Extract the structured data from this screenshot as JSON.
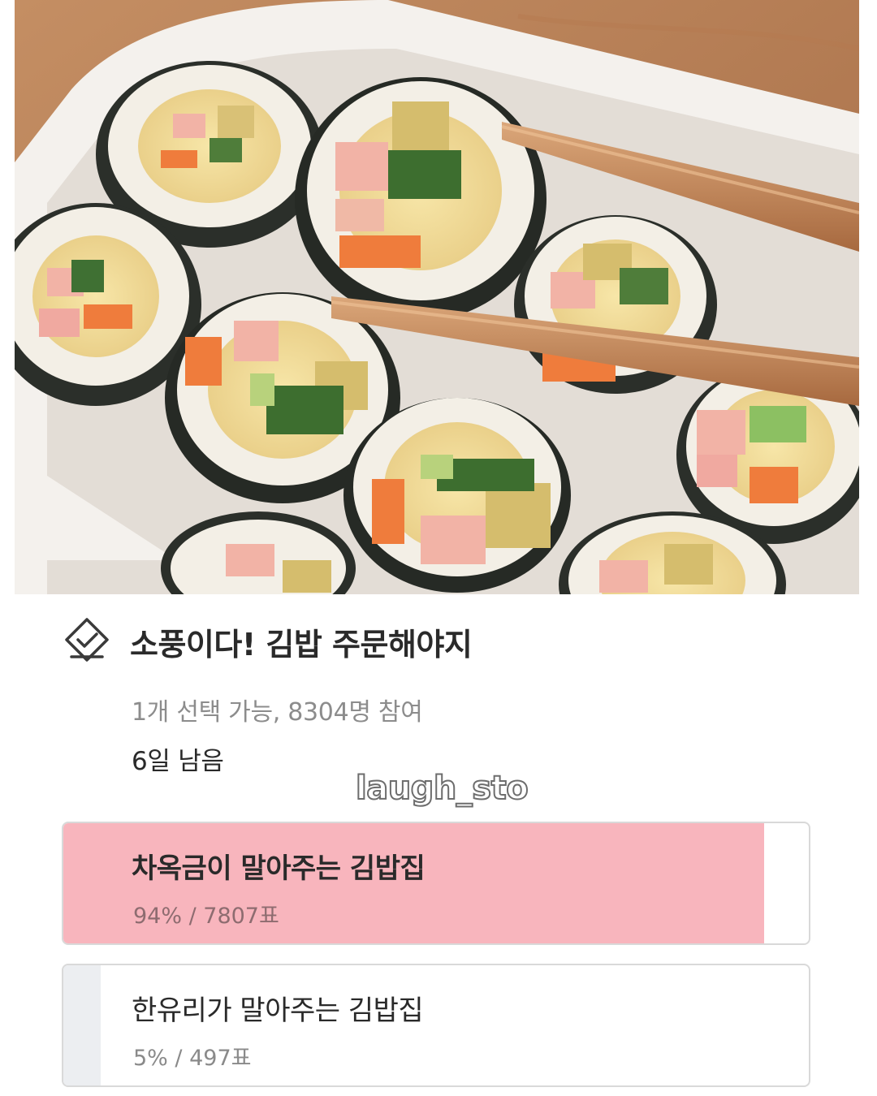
{
  "hero": {
    "image": "kimbap-photo"
  },
  "poll": {
    "icon": "ballot-check-icon",
    "title": "소풍이다! 김밥 주문해야지",
    "meta": "1개 선택 가능, 8304명 참여",
    "deadline": "6일 남음",
    "options": [
      {
        "label": "차옥금이 말아주는 김밥집",
        "percent": 94,
        "result": "94% / 7807표",
        "selected": true
      },
      {
        "label": "한유리가 말아주는 김밥집",
        "percent": 5,
        "result": "5% / 497표",
        "selected": false
      }
    ]
  },
  "watermark": "laugh_sto",
  "colors": {
    "selected_fill": "#f8b5bd",
    "unselected_fill": "#eceef1",
    "border": "#d9d9d9",
    "title_text": "#2a2a2a",
    "meta_text": "#8c8c8c"
  }
}
